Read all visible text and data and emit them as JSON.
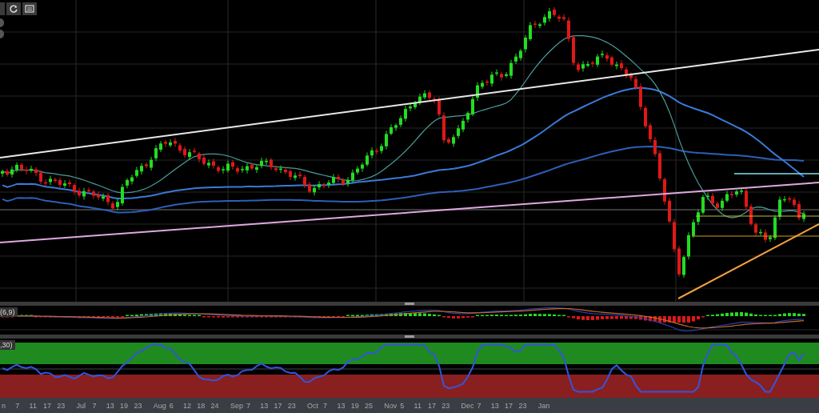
{
  "macd_panel": {
    "label": "(6,9)"
  },
  "rsi_panel": {
    "label": ",30)"
  },
  "time_axis": {
    "labels": [
      "n",
      "7",
      "11",
      "17",
      "23",
      "Jul",
      "7",
      "13",
      "19",
      "23",
      "Aug",
      "6",
      "12",
      "18",
      "24",
      "Sep",
      "7",
      "13",
      "17",
      "23",
      "Oct",
      "7",
      "13",
      "19",
      "25",
      "Nov",
      "5",
      "11",
      "17",
      "23",
      "Dec",
      "7",
      "13",
      "17",
      "23",
      "Jan"
    ]
  }
}
